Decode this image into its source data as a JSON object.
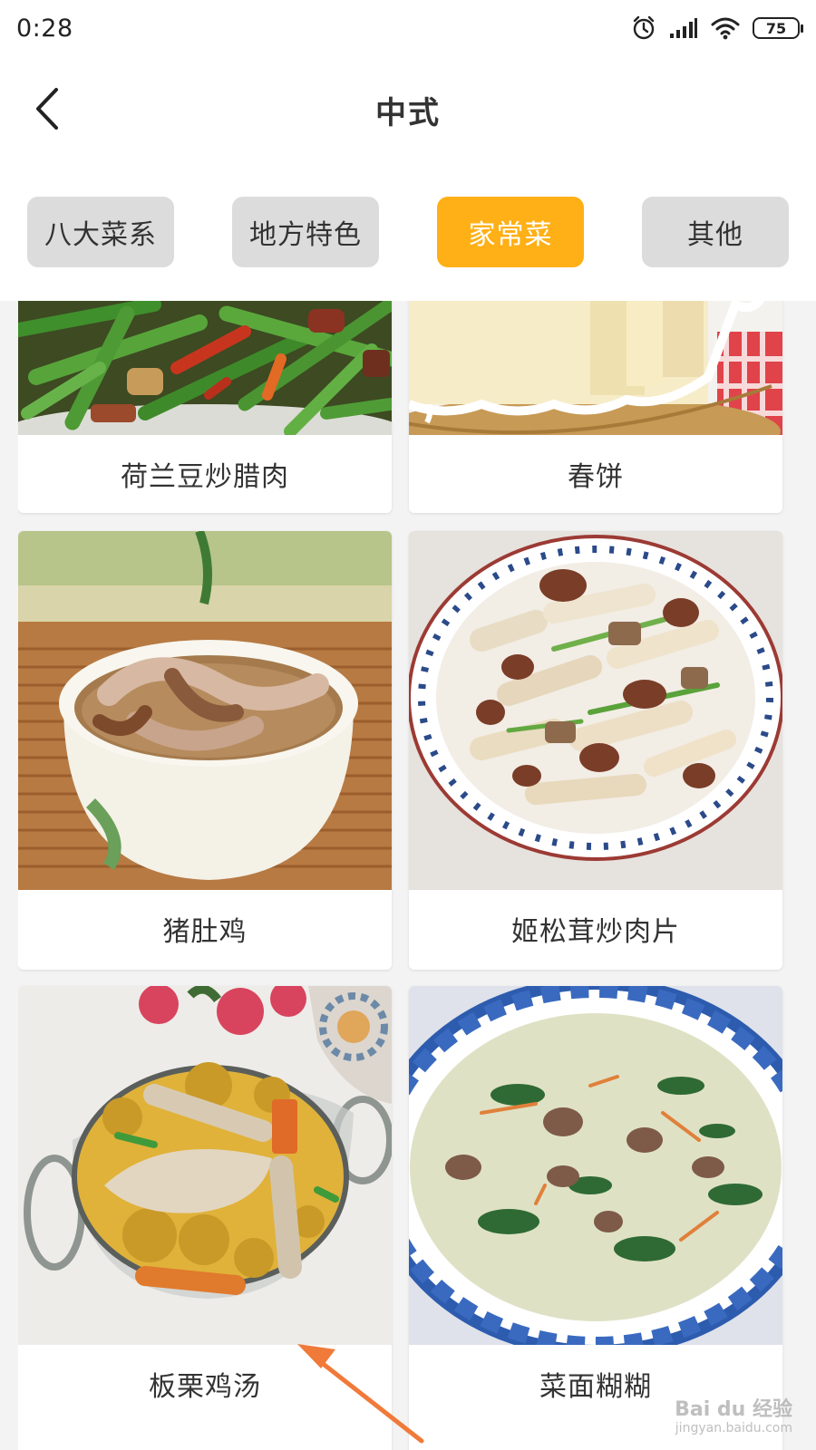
{
  "status_bar": {
    "time": "0:28",
    "battery_level": "75",
    "icons": [
      "alarm-icon",
      "cellular-signal-icon",
      "wifi-icon",
      "battery-icon"
    ]
  },
  "header": {
    "title": "中式",
    "back_icon": "chevron-left-icon"
  },
  "tabs": [
    {
      "label": "八大菜系",
      "active": false
    },
    {
      "label": "地方特色",
      "active": false
    },
    {
      "label": "家常菜",
      "active": true
    },
    {
      "label": "其他",
      "active": false
    }
  ],
  "recipes": [
    {
      "name": "荷兰豆炒腊肉"
    },
    {
      "name": "春饼"
    },
    {
      "name": "猪肚鸡"
    },
    {
      "name": "姬松茸炒肉片"
    },
    {
      "name": "板栗鸡汤"
    },
    {
      "name": "菜面糊糊"
    }
  ],
  "watermark": {
    "brand": "Bai du 经验",
    "url": "jingyan.baidu.com"
  },
  "colors": {
    "accent": "#ffb016",
    "tab_inactive": "#dcdcdc",
    "background": "#f3f3f3",
    "annotation_arrow": "#f07a3a"
  }
}
